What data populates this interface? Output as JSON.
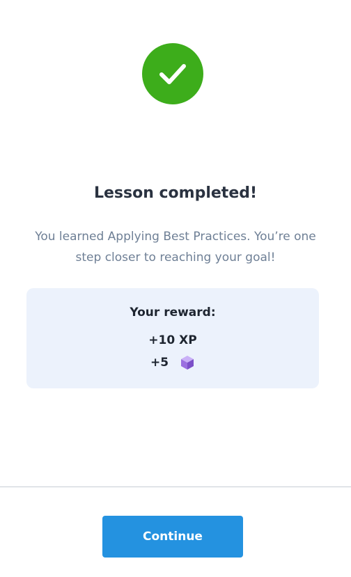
{
  "icons": {
    "success": "check-icon",
    "gem": "gem-icon"
  },
  "colors": {
    "success_badge": "#3dad1b",
    "title_text": "#2a3240",
    "subtitle_text": "#6e7f95",
    "reward_card_bg": "#ecf2fc",
    "gem_purple": "#9b6fe0",
    "continue_button": "#2492e0",
    "divider": "#c6ccd4"
  },
  "lesson": {
    "title": "Lesson completed!",
    "message": "You learned Applying Best Practices. You’re one step closer to reaching your goal!"
  },
  "reward": {
    "heading": "Your reward:",
    "xp": "+10 XP",
    "gems": "+5"
  },
  "footer": {
    "continue_label": "Continue"
  }
}
